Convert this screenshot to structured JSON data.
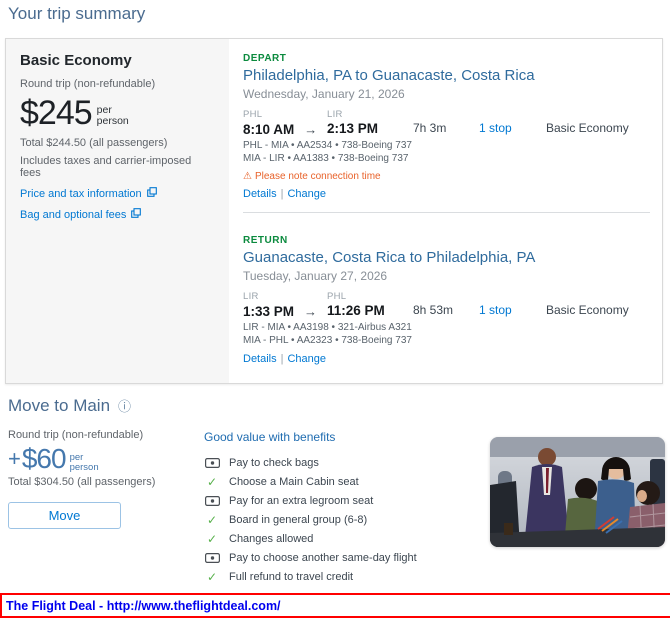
{
  "page": {
    "title": "Your trip summary"
  },
  "glyphs": {
    "arrow_right": "→",
    "pipe": "|",
    "info": "ⓘ",
    "warning": "⚠",
    "check": "✓"
  },
  "colors": {
    "link_blue": "#0078d2",
    "heading_blue": "#4a6b8f",
    "slice_label_green": "#0b8a3e",
    "warning_orange": "#e8622a",
    "check_green": "#58b14c",
    "fare_panel_bg": "#f6f6f6",
    "banner_border": "#ff0000",
    "banner_text": "#0000ee"
  },
  "fare_panel": {
    "name": "Basic Economy",
    "trip_type": "Round trip (non-refundable)",
    "price": "$245",
    "per_line1": "per",
    "per_line2": "person",
    "total": "Total $244.50 (all passengers)",
    "includes": "Includes taxes and carrier-imposed fees",
    "price_tax_link": "Price and tax information",
    "bag_fees_link": "Bag and optional fees"
  },
  "slices": [
    {
      "label": "DEPART",
      "route": "Philadelphia, PA to Guanacaste, Costa Rica",
      "date": "Wednesday, January 21, 2026",
      "origin": "PHL",
      "destination": "LIR",
      "depart_time": "8:10 AM",
      "arrive_time": "2:13 PM",
      "duration": "7h 3m",
      "stops": "1 stop",
      "cabin": "Basic Economy",
      "segments": [
        "PHL - MIA • AA2534 • 738-Boeing 737",
        "MIA - LIR • AA1383 • 738-Boeing 737"
      ],
      "warning": "Please note connection time",
      "details": "Details",
      "change": "Change"
    },
    {
      "label": "RETURN",
      "route": "Guanacaste, Costa Rica to Philadelphia, PA",
      "date": "Tuesday, January 27, 2026",
      "origin": "LIR",
      "destination": "PHL",
      "depart_time": "1:33 PM",
      "arrive_time": "11:26 PM",
      "duration": "8h 53m",
      "stops": "1 stop",
      "cabin": "Basic Economy",
      "segments": [
        "LIR - MIA • AA3198 • 321-Airbus A321",
        "MIA - PHL • AA2323 • 738-Boeing 737"
      ],
      "details": "Details",
      "change": "Change"
    }
  ],
  "upsell": {
    "title": "Move to Main",
    "trip_type": "Round trip (non-refundable)",
    "price_prefix": "+",
    "price": "$60",
    "per_line1": "per",
    "per_line2": "person",
    "total": "Total $304.50 (all passengers)",
    "move_button": "Move",
    "benefits_title": "Good value with benefits",
    "benefits": [
      {
        "icon": "money-icon",
        "label": "Pay to check bags"
      },
      {
        "icon": "check-icon",
        "label": "Choose a Main Cabin seat"
      },
      {
        "icon": "money-icon",
        "label": "Pay for an extra legroom seat"
      },
      {
        "icon": "check-icon",
        "label": "Board in general group (6-8)"
      },
      {
        "icon": "check-icon",
        "label": "Changes allowed"
      },
      {
        "icon": "money-icon",
        "label": "Pay to choose another same-day flight"
      },
      {
        "icon": "check-icon",
        "label": "Full refund to travel credit"
      }
    ]
  },
  "banner": {
    "text": "The Flight Deal - http://www.theflightdeal.com/"
  }
}
